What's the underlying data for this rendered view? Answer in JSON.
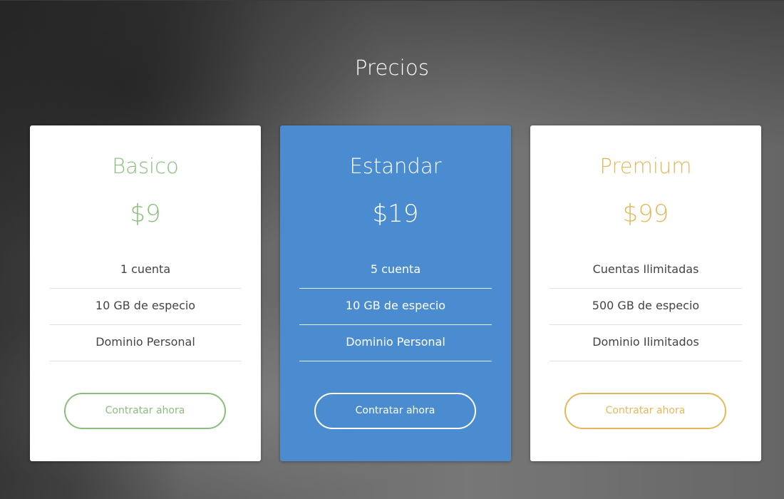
{
  "section": {
    "title": "Precios"
  },
  "colors": {
    "basic_accent": "#8bbd7b",
    "standard_bg": "#4a8ccf",
    "premium_accent": "#e2b95a"
  },
  "plans": [
    {
      "name": "Basico",
      "price": "$9",
      "features": [
        "1 cuenta",
        "10 GB de especio",
        "Dominio Personal"
      ],
      "cta_label": "Contratar ahora"
    },
    {
      "name": "Estandar",
      "price": "$19",
      "features": [
        "5 cuenta",
        "10 GB de especio",
        "Dominio Personal"
      ],
      "cta_label": "Contratar ahora"
    },
    {
      "name": "Premium",
      "price": "$99",
      "features": [
        "Cuentas Ilimitadas",
        "500 GB de especio",
        "Dominio Ilimitados"
      ],
      "cta_label": "Contratar ahora"
    }
  ]
}
